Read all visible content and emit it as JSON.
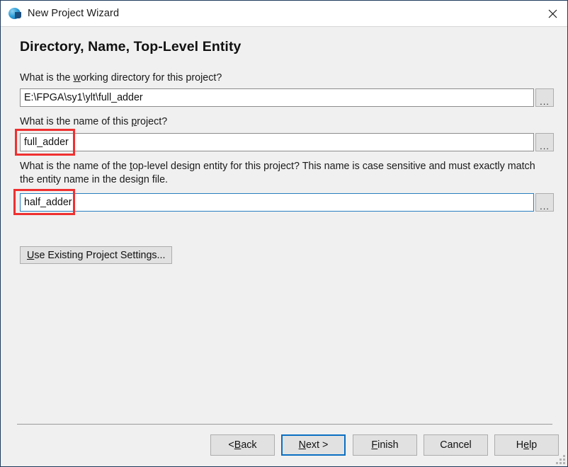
{
  "window": {
    "title": "New Project Wizard",
    "app_icon": "quartus-globe-icon",
    "close_label": "×"
  },
  "page": {
    "heading": "Directory, Name, Top-Level Entity"
  },
  "fields": {
    "working_directory": {
      "label_before": "What is the ",
      "label_accel": "w",
      "label_after": "orking directory for this project?",
      "label_full": "What is the working directory for this project?",
      "value": "E:\\FPGA\\sy1\\ylt\\full_adder",
      "browse_label": "...",
      "focused": false
    },
    "project_name": {
      "label_before": "What is the name of this ",
      "label_accel": "p",
      "label_after": "roject?",
      "label_full": "What is the name of this project?",
      "value": "full_adder",
      "browse_label": "...",
      "focused": false
    },
    "top_level_entity": {
      "label_before": "What is the name of the ",
      "label_accel": "t",
      "label_after": "op-level design entity for this project? This name is case sensitive and must exactly match the entity name in the design file.",
      "label_full": "What is the name of the top-level design entity for this project? This name is case sensitive and must exactly match the entity name in the design file.",
      "value": "half_adder",
      "browse_label": "...",
      "focused": true
    }
  },
  "buttons": {
    "use_existing": {
      "accel": "U",
      "rest": "se Existing Project Settings...",
      "full": "Use Existing Project Settings..."
    },
    "footer": [
      {
        "id": "back",
        "before": "< ",
        "accel": "B",
        "after": "ack",
        "full": "< Back",
        "focused": false
      },
      {
        "id": "next",
        "before": "",
        "accel": "N",
        "after": "ext >",
        "full": "Next >",
        "focused": true
      },
      {
        "id": "finish",
        "before": "",
        "accel": "F",
        "after": "inish",
        "full": "Finish",
        "focused": false
      },
      {
        "id": "cancel",
        "before": "Cancel",
        "accel": "",
        "after": "",
        "full": "Cancel",
        "focused": false
      },
      {
        "id": "help",
        "before": "H",
        "accel": "e",
        "after": "lp",
        "full": "Help",
        "focused": false
      }
    ]
  },
  "annotations": {
    "color": "#f03030",
    "boxes": [
      {
        "target": "project-name-input"
      },
      {
        "target": "top-level-entity-input"
      }
    ]
  }
}
